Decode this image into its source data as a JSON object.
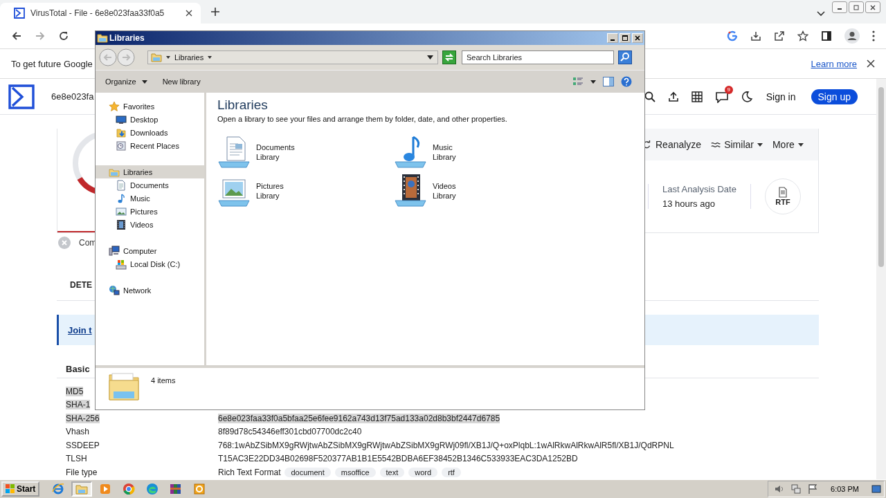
{
  "browser": {
    "tab": {
      "title": "VirusTotal - File - 6e8e023faa33f0a5"
    },
    "infobar": {
      "text": "To get future Google",
      "link": "Learn more"
    }
  },
  "virustotal": {
    "search_text": "6e8e023fa",
    "notification_count": "9",
    "sign_in": "Sign in",
    "sign_up": "Sign up",
    "actions": [
      {
        "label": "Reanalyze",
        "kind": "reload"
      },
      {
        "label": "Similar",
        "kind": "similar"
      },
      {
        "label": "More",
        "kind": "more"
      }
    ],
    "last_analysis": {
      "label": "Last Analysis Date",
      "value": "13 hours ago"
    },
    "file_badge": "RTF",
    "community": "Com",
    "tab": "DETE",
    "join_link": "Join t",
    "section": "Basic",
    "properties": [
      {
        "label": "MD5",
        "selected": true
      },
      {
        "label": "SHA-1",
        "selected": true
      },
      {
        "label": "SHA-256",
        "value": "6e8e023faa33f0a5bfaa25e6fee9162a743d13f75ad133a02d8b3bf2447d6785",
        "selected": true
      },
      {
        "label": "Vhash",
        "value": "8f89d78c54346eff301cbd07700dc2c40",
        "selected": false
      },
      {
        "label": "SSDEEP",
        "value": "768:1wAbZSibMX9gRWjtwAbZSibMX9gRWjtwAbZSibMX9gRWj09fl/XB1J/Q+oxPlqbL:1wAlRkwAlRkwAlR5fl/XB1J/QdRPNL",
        "selected": false
      },
      {
        "label": "TLSH",
        "value": "T15AC3E22DD34B02698F520377AB1B1E5542BDBA6EF38452B1346C533933EAC3DA1252BD",
        "selected": false
      },
      {
        "label": "File type",
        "value": "Rich Text Format",
        "tags": [
          "document",
          "msoffice",
          "text",
          "word",
          "rtf"
        ],
        "selected": false
      }
    ]
  },
  "explorer": {
    "title": "Libraries",
    "breadcrumb": "Libraries",
    "search": {
      "placeholder": "Search Libraries"
    },
    "toolbar": [
      "Organize",
      "New library"
    ],
    "nav": [
      {
        "label": "Favorites",
        "kind": "star",
        "selected": false,
        "children": [
          {
            "label": "Desktop",
            "kind": "desktop",
            "selected": false
          },
          {
            "label": "Downloads",
            "kind": "downloads",
            "selected": false
          },
          {
            "label": "Recent Places",
            "kind": "recent",
            "selected": false
          }
        ]
      },
      {
        "label": "Libraries",
        "kind": "library",
        "selected": true,
        "children": [
          {
            "label": "Documents",
            "kind": "documents",
            "selected": false
          },
          {
            "label": "Music",
            "kind": "music",
            "selected": false
          },
          {
            "label": "Pictures",
            "kind": "pictures",
            "selected": false
          },
          {
            "label": "Videos",
            "kind": "videos",
            "selected": false
          }
        ]
      },
      {
        "label": "Computer",
        "kind": "computer",
        "selected": false,
        "children": [
          {
            "label": "Local Disk (C:)",
            "kind": "disk",
            "selected": false
          }
        ]
      },
      {
        "label": "Network",
        "kind": "network",
        "selected": false
      }
    ],
    "heading": "Libraries",
    "description": "Open a library to see your files and arrange them by folder, date, and other properties.",
    "items": [
      {
        "name": "Documents",
        "type": "Library",
        "kind": "documents"
      },
      {
        "name": "Music",
        "type": "Library",
        "kind": "music"
      },
      {
        "name": "Pictures",
        "type": "Library",
        "kind": "pictures"
      },
      {
        "name": "Videos",
        "type": "Library",
        "kind": "videos"
      }
    ],
    "status": "4 items"
  },
  "taskbar": {
    "start": "Start",
    "apps": [
      {
        "kind": "ie",
        "selected": false
      },
      {
        "kind": "folder",
        "selected": true
      },
      {
        "kind": "media",
        "selected": false
      },
      {
        "kind": "chrome",
        "selected": false
      },
      {
        "kind": "edge",
        "selected": false
      },
      {
        "kind": "archive",
        "selected": false
      },
      {
        "kind": "office",
        "selected": false
      }
    ],
    "clock": "6:03 PM"
  }
}
